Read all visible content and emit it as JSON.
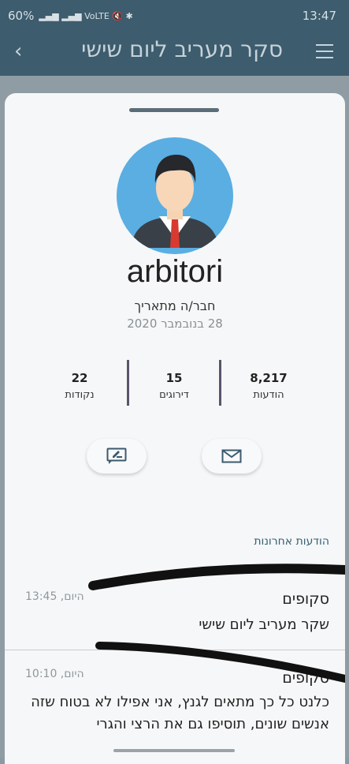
{
  "status": {
    "battery": "60%",
    "time": "13:47"
  },
  "appbar": {
    "title": "סקר מעריב ליום שישי"
  },
  "profile": {
    "username": "arbitori",
    "member_label": "חבר/ה מתאריך",
    "joined_date": "28 בנובמבר 2020",
    "stats": [
      {
        "value": "8,217",
        "label": "הודעות"
      },
      {
        "value": "15",
        "label": "דירוגים"
      },
      {
        "value": "22",
        "label": "נקודות"
      }
    ]
  },
  "actions": {
    "message_icon": "envelope-icon",
    "profile_icon": "edit-profile-icon"
  },
  "recent_title": "הודעות אחרונות",
  "posts": [
    {
      "author": "סקופים",
      "time": "היום, 13:45",
      "text": "שקר מעריב ליום שישי"
    },
    {
      "author": "סקופים",
      "time": "היום, 10:10",
      "text": "כלנט כל כך מתאים לגנץ, אני אפילו לא בטוח שזה אנשים שונים, תוסיפו גם את הרצי והגרי"
    }
  ]
}
